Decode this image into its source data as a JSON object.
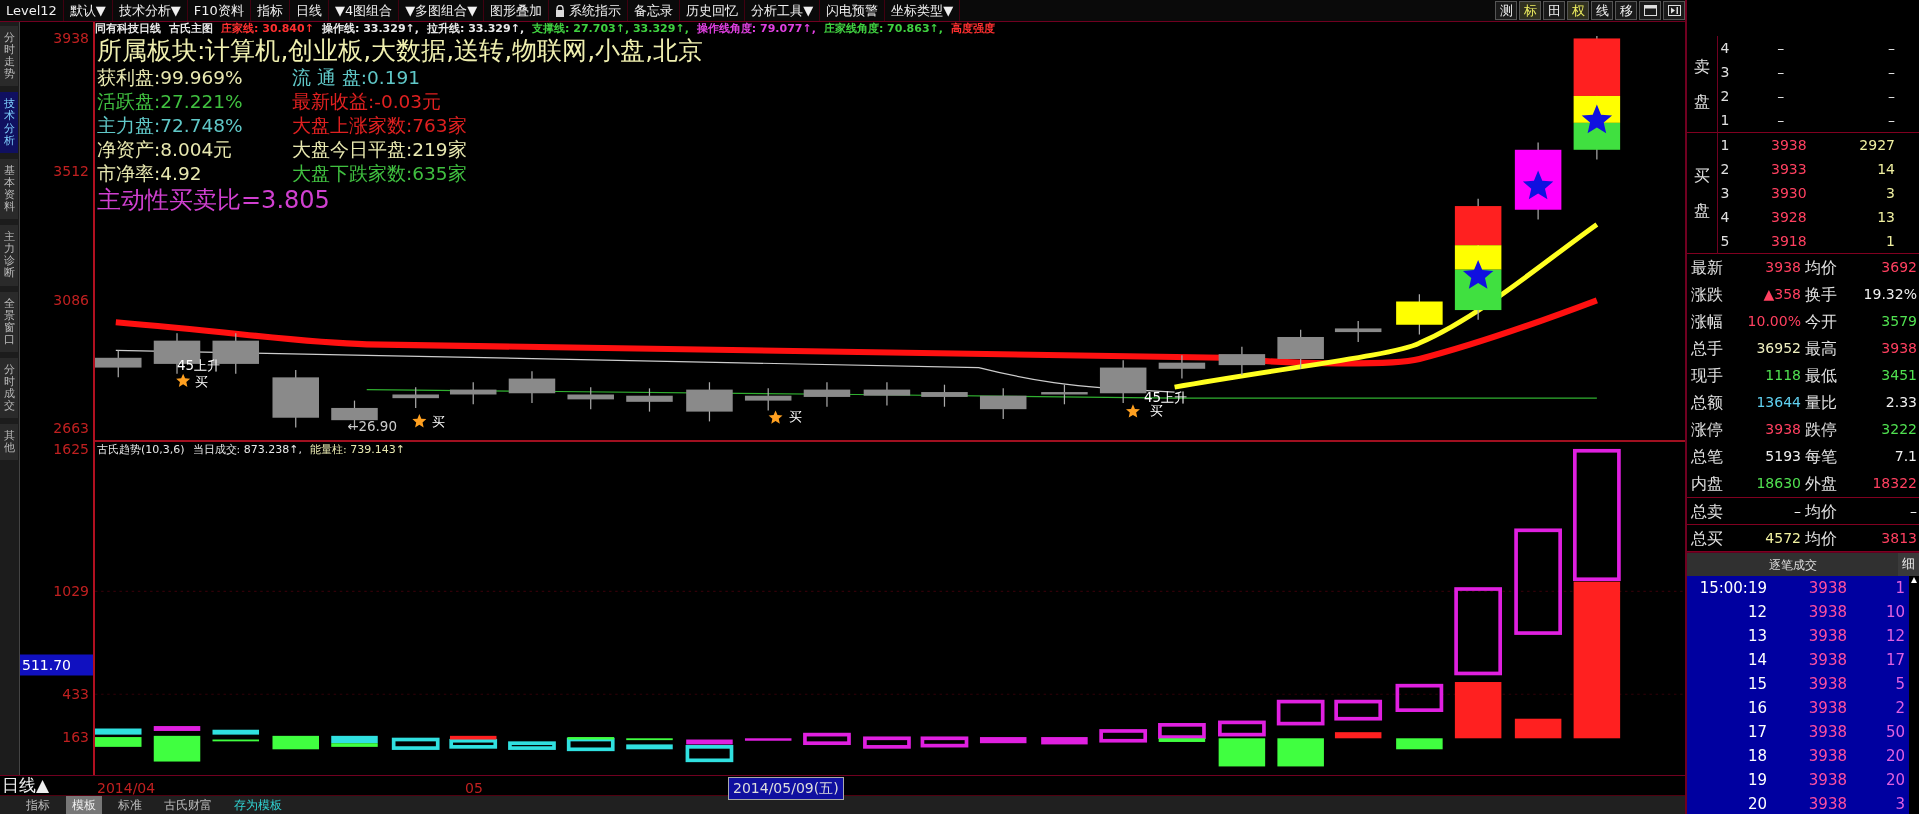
{
  "menu": [
    {
      "label": "Level12"
    },
    {
      "label": "默认▼"
    },
    {
      "label": "技术分析▼"
    },
    {
      "label": "F10资料"
    },
    {
      "label": "指标"
    },
    {
      "label": "日线"
    },
    {
      "label": "▼4图组合"
    },
    {
      "label": "▼多图组合▼"
    },
    {
      "label": "图形叠加"
    },
    {
      "label": "系统指示",
      "lock": true
    },
    {
      "label": "备忘录"
    },
    {
      "label": "历史回忆"
    },
    {
      "label": "分析工具▼"
    },
    {
      "label": "闪电预警"
    },
    {
      "label": "坐标类型▼"
    }
  ],
  "toolbar": [
    {
      "label": "测",
      "highlighted": false
    },
    {
      "label": "标",
      "highlighted": true
    },
    {
      "label": "田",
      "highlighted": false
    },
    {
      "label": "权",
      "highlighted": true
    },
    {
      "label": "线",
      "highlighted": false
    },
    {
      "label": "移",
      "highlighted": false
    }
  ],
  "side_tabs": [
    {
      "label": "分时走势",
      "selected": false
    },
    {
      "label": "技术分析",
      "selected": true
    },
    {
      "label": "基本资料",
      "selected": false
    },
    {
      "label": "主力诊断",
      "selected": false
    },
    {
      "label": "全景窗口",
      "selected": false
    },
    {
      "label": "分时成交",
      "selected": false
    },
    {
      "label": "其他",
      "selected": false
    }
  ],
  "chart_header": [
    {
      "text": "同有科技日线",
      "color": "#e8e8e8"
    },
    {
      "text": "古氏主图",
      "color": "#e8e8e8"
    },
    {
      "text": "庄家线: 30.840↑",
      "color": "#ff3030"
    },
    {
      "text": "操作线: 33.329↑,",
      "color": "#e8e8e8"
    },
    {
      "text": "拉升线: 33.329↑,",
      "color": "#e8e8e8"
    },
    {
      "text": "支撑线: 27.703↑, 33.329↑,",
      "color": "#40d040"
    },
    {
      "text": "操作线角度: 79.077↑,",
      "color": "#e040e0"
    },
    {
      "text": "庄家线角度: 70.863↑,",
      "color": "#40d040"
    },
    {
      "text": "高度强度",
      "color": "#ff3030"
    }
  ],
  "info": {
    "title": "所属板块:计算机,创业板,大数据,送转,物联网,小盘,北京",
    "rows": [
      [
        {
          "text": "获利盘:99.969%",
          "color": "#e8e8b0"
        },
        {
          "text": "流 通 盘:0.191",
          "color": "#60c8c8"
        }
      ],
      [
        {
          "text": "活跃盘:27.221%",
          "color": "#40c040"
        },
        {
          "text": "最新收益:-0.03元",
          "color": "#e02020"
        }
      ],
      [
        {
          "text": "主力盘:72.748%",
          "color": "#60c8c8"
        },
        {
          "text": "大盘上涨家数:763家",
          "color": "#e02020"
        }
      ],
      [
        {
          "text": "净资产:8.004元",
          "color": "#e8e8b0"
        },
        {
          "text": "大盘今日平盘:219家",
          "color": "#e8e8b0"
        }
      ],
      [
        {
          "text": "市净率:4.92",
          "color": "#e8e8b0"
        },
        {
          "text": "大盘下跌家数:635家",
          "color": "#40c040"
        }
      ]
    ],
    "ratio": "主动性买卖比=3.805"
  },
  "price_axis": [
    "3938",
    "3512",
    "3086",
    "2663"
  ],
  "annotations": [
    {
      "text": "45上升"
    },
    {
      "text": "买"
    },
    {
      "text": "←26.90"
    },
    {
      "text": "买"
    },
    {
      "text": "买"
    },
    {
      "text": "45上升"
    },
    {
      "text": "买"
    }
  ],
  "lower_header": [
    {
      "text": "古氏趋势(10,3,6)",
      "color": "#e8e8e8"
    },
    {
      "text": "当日成交: 873.238↑,",
      "color": "#e8e8e8"
    },
    {
      "text": "能量柱: 739.143↑",
      "color": "#e8e8b0"
    }
  ],
  "lower_axis": [
    "1625",
    "1029",
    "433",
    "163"
  ],
  "lower_cursor": "511.70",
  "date_axis": {
    "period": "日线▲",
    "labels": [
      "2014/04",
      "05"
    ],
    "cursor": "2014/05/09(五)"
  },
  "bottom_tabs": [
    {
      "label": "指标",
      "selected": false,
      "kind": "tab"
    },
    {
      "label": "模板",
      "selected": true,
      "kind": "tab"
    },
    {
      "label": "标准",
      "selected": false,
      "kind": "tab"
    },
    {
      "label": "古氏财富",
      "selected": false,
      "kind": "tab"
    },
    {
      "label": "存为模板",
      "selected": false,
      "kind": "action"
    }
  ],
  "quote": {
    "sell_label": "卖盘",
    "buy_label": "买盘",
    "sell": [
      {
        "level": "4",
        "price": "–",
        "volume": "–"
      },
      {
        "level": "3",
        "price": "–",
        "volume": "–"
      },
      {
        "level": "2",
        "price": "–",
        "volume": "–"
      },
      {
        "level": "1",
        "price": "–",
        "volume": "–"
      }
    ],
    "buy": [
      {
        "level": "1",
        "price": "3938",
        "volume": "2927"
      },
      {
        "level": "2",
        "price": "3933",
        "volume": "14"
      },
      {
        "level": "3",
        "price": "3930",
        "volume": "3"
      },
      {
        "level": "4",
        "price": "3928",
        "volume": "13"
      },
      {
        "level": "5",
        "price": "3918",
        "volume": "1"
      }
    ],
    "stats": [
      [
        {
          "label": "最新",
          "value": "3938",
          "color": "#ff4060"
        },
        {
          "label": "均价",
          "value": "3692",
          "color": "#ff4060"
        }
      ],
      [
        {
          "label": "涨跌",
          "value": "▲358",
          "color": "#ff4060"
        },
        {
          "label": "换手",
          "value": "19.32%",
          "color": "#f0f0f0"
        }
      ],
      [
        {
          "label": "涨幅",
          "value": "10.00%",
          "color": "#ff4060"
        },
        {
          "label": "今开",
          "value": "3579",
          "color": "#50e050"
        }
      ],
      [
        {
          "label": "总手",
          "value": "36952",
          "color": "#f0f0c0"
        },
        {
          "label": "最高",
          "value": "3938",
          "color": "#ff4060"
        }
      ],
      [
        {
          "label": "现手",
          "value": "1118",
          "color": "#50e050"
        },
        {
          "label": "最低",
          "value": "3451",
          "color": "#50e050"
        }
      ],
      [
        {
          "label": "总额",
          "value": "13644",
          "color": "#60d0f0"
        },
        {
          "label": "量比",
          "value": "2.33",
          "color": "#f0f0f0"
        }
      ],
      [
        {
          "label": "涨停",
          "value": "3938",
          "color": "#ff4060"
        },
        {
          "label": "跌停",
          "value": "3222",
          "color": "#50e050"
        }
      ],
      [
        {
          "label": "总笔",
          "value": "5193",
          "color": "#f0f0f0"
        },
        {
          "label": "每笔",
          "value": "7.1",
          "color": "#f0f0f0"
        }
      ],
      [
        {
          "label": "内盘",
          "value": "18630",
          "color": "#50e050"
        },
        {
          "label": "外盘",
          "value": "18322",
          "color": "#ff4060"
        }
      ]
    ],
    "totals": [
      [
        {
          "label": "总卖",
          "value": "–",
          "color": "#f0f0f0"
        },
        {
          "label": "均价",
          "value": "–",
          "color": "#f0f0f0"
        }
      ],
      [
        {
          "label": "总买",
          "value": "4572",
          "color": "#f0f0a0"
        },
        {
          "label": "均价",
          "value": "3813",
          "color": "#ff4060"
        }
      ]
    ]
  },
  "trades": {
    "title": "逐笔成交",
    "detail_button": "细",
    "rows": [
      {
        "time": "15:00:19",
        "price": "3938",
        "volume": "1"
      },
      {
        "time": "12",
        "price": "3938",
        "volume": "10"
      },
      {
        "time": "13",
        "price": "3938",
        "volume": "12"
      },
      {
        "time": "14",
        "price": "3938",
        "volume": "17"
      },
      {
        "time": "15",
        "price": "3938",
        "volume": "5"
      },
      {
        "time": "16",
        "price": "3938",
        "volume": "2"
      },
      {
        "time": "17",
        "price": "3938",
        "volume": "50"
      },
      {
        "time": "18",
        "price": "3938",
        "volume": "20"
      },
      {
        "time": "19",
        "price": "3938",
        "volume": "20"
      },
      {
        "time": "20",
        "price": "3938",
        "volume": "3"
      }
    ]
  }
}
